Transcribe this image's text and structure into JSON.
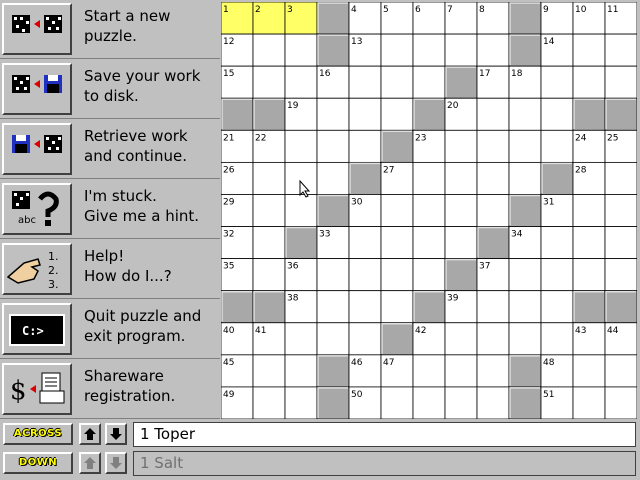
{
  "menu": [
    {
      "label": "Start a new\npuzzle.",
      "icon": "new-puzzle-icon"
    },
    {
      "label": "Save your work\nto disk.",
      "icon": "save-disk-icon"
    },
    {
      "label": "Retrieve work\nand continue.",
      "icon": "retrieve-disk-icon"
    },
    {
      "label": "I'm stuck.\nGive me a hint.",
      "icon": "hint-question-icon"
    },
    {
      "label": "Help!\nHow do I...?",
      "icon": "help-hand-icon"
    },
    {
      "label": "Quit puzzle and\nexit program.",
      "icon": "dos-prompt-icon"
    },
    {
      "label": "Shareware\nregistration.",
      "icon": "dollar-printer-icon"
    }
  ],
  "icons": {
    "dos_prompt": "C:>",
    "hint_abc": "abc",
    "help_list": [
      "1.",
      "2.",
      "3."
    ]
  },
  "grid": {
    "size": 13,
    "black": [
      [
        0,
        3
      ],
      [
        0,
        9
      ],
      [
        1,
        3
      ],
      [
        1,
        9
      ],
      [
        2,
        7
      ],
      [
        3,
        0
      ],
      [
        3,
        1
      ],
      [
        3,
        6
      ],
      [
        3,
        12
      ],
      [
        3,
        11
      ],
      [
        4,
        5
      ],
      [
        5,
        4
      ],
      [
        5,
        10
      ],
      [
        6,
        3
      ],
      [
        6,
        9
      ],
      [
        7,
        2
      ],
      [
        7,
        8
      ],
      [
        8,
        7
      ],
      [
        9,
        0
      ],
      [
        9,
        1
      ],
      [
        9,
        6
      ],
      [
        9,
        11
      ],
      [
        9,
        12
      ],
      [
        10,
        5
      ],
      [
        11,
        3
      ],
      [
        11,
        9
      ],
      [
        12,
        3
      ],
      [
        12,
        9
      ]
    ],
    "highlight": [
      [
        0,
        0
      ],
      [
        0,
        1
      ],
      [
        0,
        2
      ]
    ],
    "numbers": [
      {
        "r": 0,
        "c": 0,
        "n": "1"
      },
      {
        "r": 0,
        "c": 1,
        "n": "2"
      },
      {
        "r": 0,
        "c": 2,
        "n": "3"
      },
      {
        "r": 0,
        "c": 4,
        "n": "4"
      },
      {
        "r": 0,
        "c": 5,
        "n": "5"
      },
      {
        "r": 0,
        "c": 6,
        "n": "6"
      },
      {
        "r": 0,
        "c": 7,
        "n": "7"
      },
      {
        "r": 0,
        "c": 8,
        "n": "8"
      },
      {
        "r": 0,
        "c": 10,
        "n": "9"
      },
      {
        "r": 0,
        "c": 11,
        "n": "10"
      },
      {
        "r": 0,
        "c": 12,
        "n": "11"
      },
      {
        "r": 1,
        "c": 0,
        "n": "12"
      },
      {
        "r": 1,
        "c": 4,
        "n": "13"
      },
      {
        "r": 1,
        "c": 10,
        "n": "14"
      },
      {
        "r": 2,
        "c": 0,
        "n": "15"
      },
      {
        "r": 2,
        "c": 3,
        "n": "16"
      },
      {
        "r": 2,
        "c": 8,
        "n": "17"
      },
      {
        "r": 2,
        "c": 9,
        "n": "18"
      },
      {
        "r": 3,
        "c": 2,
        "n": "19"
      },
      {
        "r": 3,
        "c": 7,
        "n": "20"
      },
      {
        "r": 4,
        "c": 0,
        "n": "21"
      },
      {
        "r": 4,
        "c": 1,
        "n": "22"
      },
      {
        "r": 4,
        "c": 6,
        "n": "23"
      },
      {
        "r": 4,
        "c": 11,
        "n": "24"
      },
      {
        "r": 4,
        "c": 12,
        "n": "25"
      },
      {
        "r": 5,
        "c": 0,
        "n": "26"
      },
      {
        "r": 5,
        "c": 5,
        "n": "27"
      },
      {
        "r": 5,
        "c": 11,
        "n": "28"
      },
      {
        "r": 6,
        "c": 0,
        "n": "29"
      },
      {
        "r": 6,
        "c": 4,
        "n": "30"
      },
      {
        "r": 6,
        "c": 10,
        "n": "31"
      },
      {
        "r": 7,
        "c": 0,
        "n": "32"
      },
      {
        "r": 7,
        "c": 3,
        "n": "33"
      },
      {
        "r": 7,
        "c": 9,
        "n": "34"
      },
      {
        "r": 8,
        "c": 0,
        "n": "35"
      },
      {
        "r": 8,
        "c": 2,
        "n": "36"
      },
      {
        "r": 8,
        "c": 8,
        "n": "37"
      },
      {
        "r": 9,
        "c": 2,
        "n": "38"
      },
      {
        "r": 9,
        "c": 7,
        "n": "39"
      },
      {
        "r": 10,
        "c": 0,
        "n": "40"
      },
      {
        "r": 10,
        "c": 1,
        "n": "41"
      },
      {
        "r": 10,
        "c": 6,
        "n": "42"
      },
      {
        "r": 10,
        "c": 11,
        "n": "43"
      },
      {
        "r": 10,
        "c": 12,
        "n": "44"
      },
      {
        "r": 11,
        "c": 0,
        "n": "45"
      },
      {
        "r": 11,
        "c": 4,
        "n": "46"
      },
      {
        "r": 11,
        "c": 5,
        "n": "47"
      },
      {
        "r": 11,
        "c": 10,
        "n": "48"
      },
      {
        "r": 12,
        "c": 0,
        "n": "49"
      },
      {
        "r": 12,
        "c": 4,
        "n": "50"
      },
      {
        "r": 12,
        "c": 10,
        "n": "51"
      }
    ]
  },
  "clues": {
    "across": {
      "button": "ACROSS",
      "text": "1  Toper",
      "active": true
    },
    "down": {
      "button": "DOWN",
      "text": "1  Salt",
      "active": false
    }
  },
  "colors": {
    "highlight": "#ffff66",
    "black_cell": "#a8a8a8",
    "active_clue_bg": "#ffffff",
    "inactive_clue_bg": "#c0c0c0"
  }
}
